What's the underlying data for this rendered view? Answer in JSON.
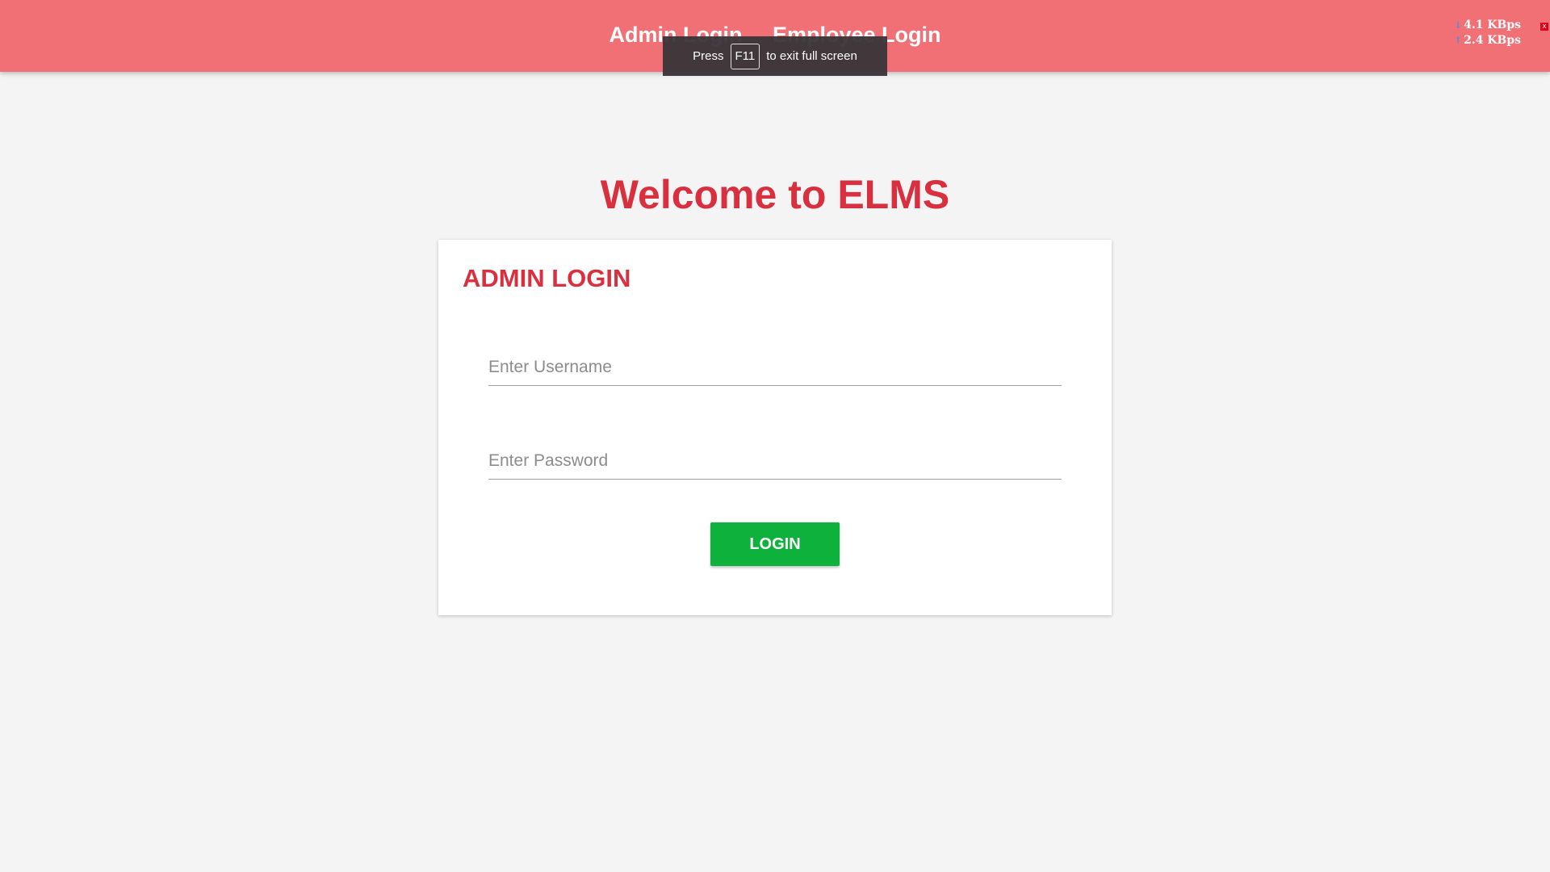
{
  "nav": {
    "admin_login": "Admin Login",
    "employee_login": "Employee Login"
  },
  "fullscreen_notice": {
    "prefix": "Press",
    "key": "F11",
    "suffix": "to exit full screen"
  },
  "net_speed": {
    "download": "4.1 KBps",
    "upload": "2.4 KBps",
    "close": "x"
  },
  "page": {
    "welcome": "Welcome to ELMS"
  },
  "login_form": {
    "title": "ADMIN LOGIN",
    "username_placeholder": "Enter Username",
    "username_value": "",
    "password_placeholder": "Enter Password",
    "password_value": "",
    "submit_label": "LOGIN"
  },
  "colors": {
    "header_bg": "#f07075",
    "accent_red": "#d9303f",
    "button_green": "#0db13b",
    "page_bg": "#f4f4f4"
  }
}
